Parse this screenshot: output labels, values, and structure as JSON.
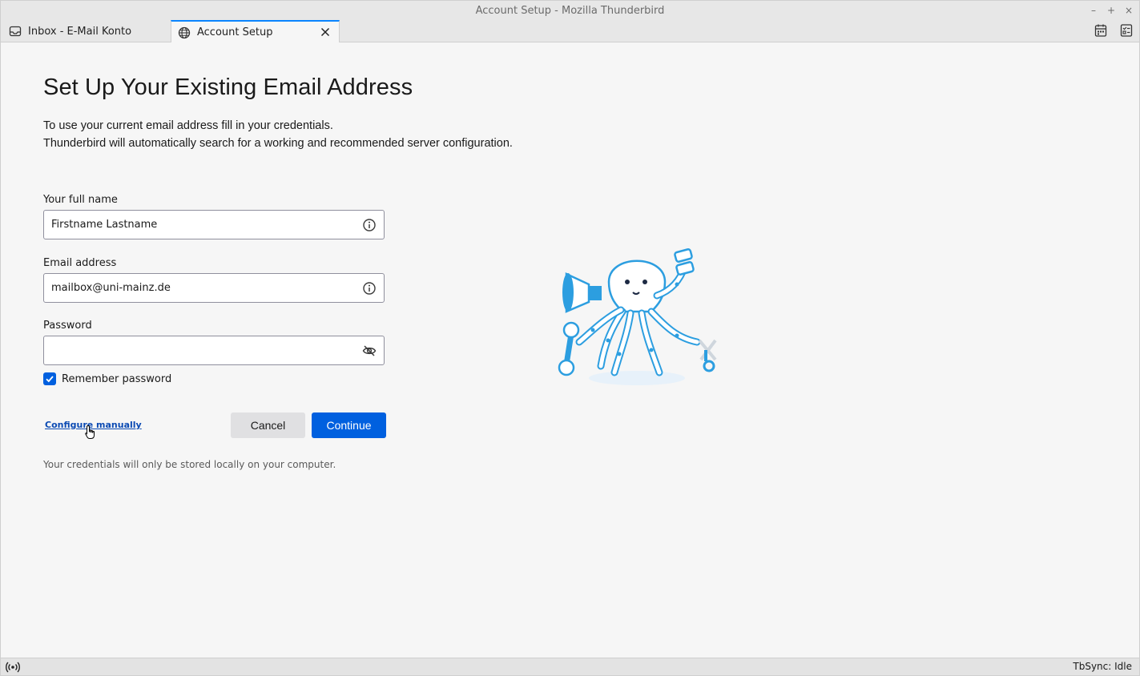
{
  "window": {
    "title": "Account Setup - Mozilla Thunderbird",
    "controls": {
      "minimize": "–",
      "maximize": "+",
      "close": "×"
    }
  },
  "tabs": [
    {
      "label": "Inbox - E-Mail Konto",
      "icon": "inbox-icon",
      "active": false
    },
    {
      "label": "Account Setup",
      "icon": "globe-icon",
      "active": true
    }
  ],
  "toolbar_icons": [
    "calendar-icon",
    "tasks-icon"
  ],
  "page": {
    "title": "Set Up Your Existing Email Address",
    "intro_line1": "To use your current email address fill in your credentials.",
    "intro_line2": "Thunderbird will automatically search for a working and recommended server configuration."
  },
  "form": {
    "full_name": {
      "label": "Your full name",
      "value": "Firstname Lastname",
      "icon": "info-icon"
    },
    "email": {
      "label": "Email address",
      "value": "mailbox@uni-mainz.de",
      "icon": "info-icon"
    },
    "password": {
      "label": "Password",
      "value": "",
      "icon": "eye-slash-icon"
    },
    "remember_password": {
      "label": "Remember password",
      "checked": true
    }
  },
  "actions": {
    "configure_manually": "Configure manually",
    "cancel": "Cancel",
    "continue": "Continue"
  },
  "privacy_note": "Your credentials will only be stored locally on your computer.",
  "status_bar": {
    "text": "TbSync: Idle",
    "icon": "online-status-icon"
  },
  "colors": {
    "accent": "#0060df",
    "link": "#0b4ab3",
    "illustration": "#2c9ee0"
  }
}
